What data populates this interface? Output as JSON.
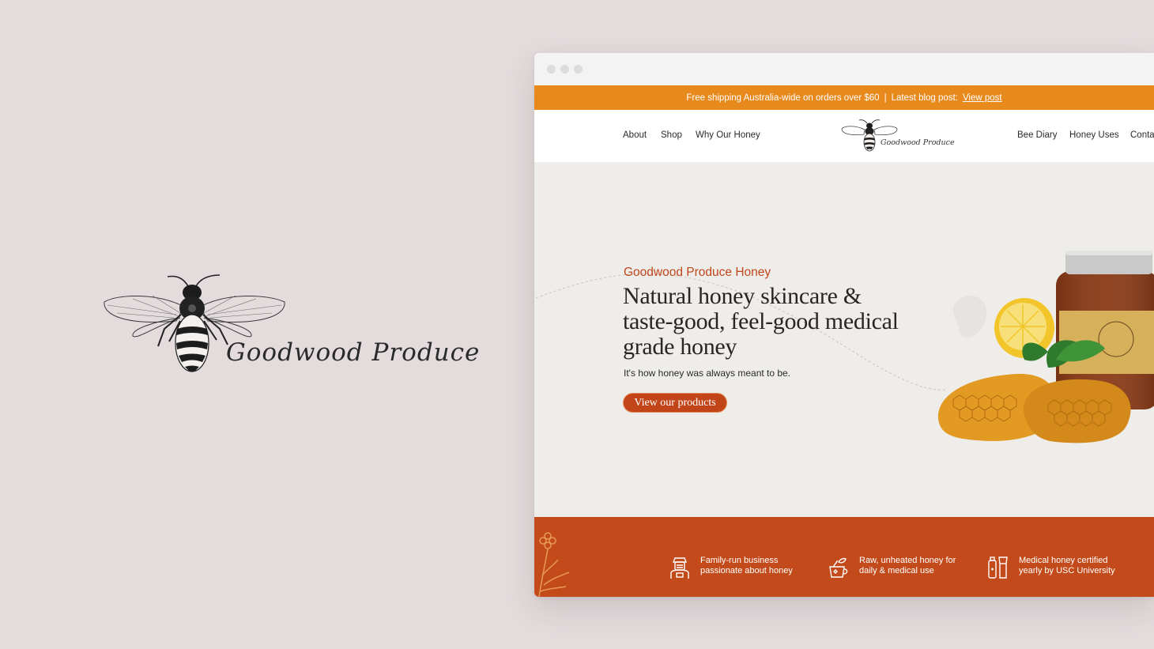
{
  "brand": {
    "name": "Goodwood Produce"
  },
  "browser": {
    "announcement": {
      "text": "Free shipping Australia-wide on orders over $60",
      "separator": "|",
      "blog_label": "Latest blog post:",
      "blog_link": "View post"
    },
    "nav": {
      "left": [
        "About",
        "Shop",
        "Why Our Honey"
      ],
      "right": [
        "Bee Diary",
        "Honey Uses",
        "Conta"
      ],
      "logo_text": "Goodwood Produce"
    },
    "hero": {
      "eyebrow": "Goodwood Produce Honey",
      "title": "Natural honey skincare & taste-good, feel-good medical grade honey",
      "subtitle": "It's how honey was always meant to be.",
      "cta": "View our products"
    },
    "features": [
      {
        "icon": "beekeeper-icon",
        "text": "Family-run business passionate about honey"
      },
      {
        "icon": "honey-cup-icon",
        "text": "Raw, unheated honey for daily & medical use"
      },
      {
        "icon": "medical-bottle-icon",
        "text": "Medical honey certified yearly by USC University"
      }
    ]
  },
  "colors": {
    "background": "#e3dbdc",
    "announce_bar": "#e8891c",
    "accent": "#c2451a",
    "feature_bar": "#c34a1a"
  }
}
